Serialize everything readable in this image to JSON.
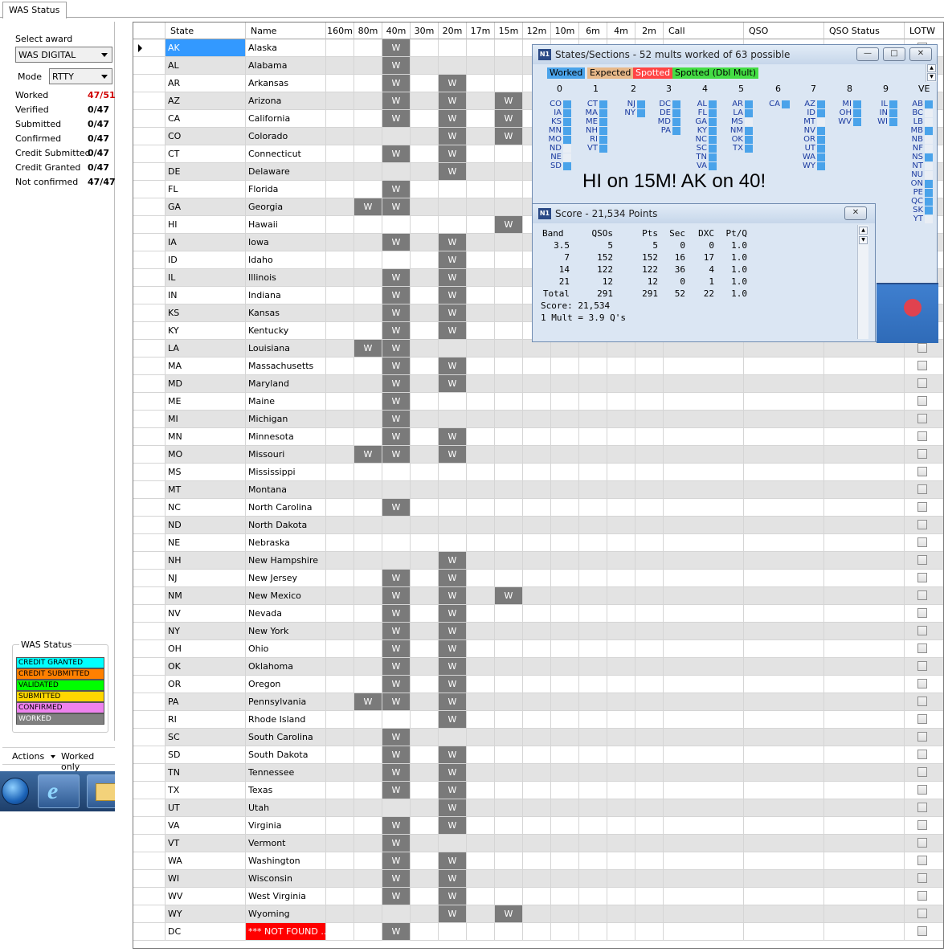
{
  "tab": {
    "label": "WAS Status"
  },
  "left": {
    "select_award_label": "Select award",
    "award_value": "WAS DIGITAL",
    "mode_label": "Mode",
    "mode_value": "RTTY",
    "stats": [
      {
        "label": "Worked",
        "value": "47/51",
        "color": "#d00000"
      },
      {
        "label": "Verified",
        "value": "0/47",
        "color": "#000000"
      },
      {
        "label": "Submitted",
        "value": "0/47",
        "color": "#000000"
      },
      {
        "label": "Confirmed",
        "value": "0/47",
        "color": "#000000"
      },
      {
        "label": "Credit Submitted",
        "value": "0/47",
        "color": "#000000"
      },
      {
        "label": "Credit Granted",
        "value": "0/47",
        "color": "#000000"
      },
      {
        "label": "Not confirmed",
        "value": "47/47",
        "color": "#000000"
      }
    ],
    "legend_title": "WAS Status",
    "legend": [
      {
        "label": "CREDIT GRANTED",
        "color": "#00ffff",
        "text": "#000"
      },
      {
        "label": "CREDIT SUBMITTED",
        "color": "#ff8000",
        "text": "#000"
      },
      {
        "label": "VALIDATED",
        "color": "#00ff00",
        "text": "#000"
      },
      {
        "label": "SUBMITTED",
        "color": "#ffd700",
        "text": "#000"
      },
      {
        "label": "CONFIRMED",
        "color": "#ee82ee",
        "text": "#000"
      },
      {
        "label": "WORKED",
        "color": "#808080",
        "text": "#ffffff"
      }
    ],
    "actions_label": "Actions",
    "worked_only_label": "Worked only"
  },
  "grid": {
    "headers": [
      "State",
      "Name",
      "160m",
      "80m",
      "40m",
      "30m",
      "20m",
      "17m",
      "15m",
      "12m",
      "10m",
      "6m",
      "4m",
      "2m",
      "Call",
      "QSO",
      "QSO Status",
      "LOTW"
    ],
    "worked_mark": "W",
    "rows": [
      {
        "state": "AK",
        "name": "Alaska",
        "worked": [
          "40m"
        ]
      },
      {
        "state": "AL",
        "name": "Alabama",
        "worked": [
          "40m"
        ]
      },
      {
        "state": "AR",
        "name": "Arkansas",
        "worked": [
          "40m",
          "20m"
        ]
      },
      {
        "state": "AZ",
        "name": "Arizona",
        "worked": [
          "40m",
          "20m",
          "15m"
        ]
      },
      {
        "state": "CA",
        "name": "California",
        "worked": [
          "40m",
          "20m",
          "15m"
        ]
      },
      {
        "state": "CO",
        "name": "Colorado",
        "worked": [
          "20m",
          "15m"
        ]
      },
      {
        "state": "CT",
        "name": "Connecticut",
        "worked": [
          "40m",
          "20m"
        ]
      },
      {
        "state": "DE",
        "name": "Delaware",
        "worked": [
          "20m"
        ]
      },
      {
        "state": "FL",
        "name": "Florida",
        "worked": [
          "40m"
        ]
      },
      {
        "state": "GA",
        "name": "Georgia",
        "worked": [
          "80m",
          "40m"
        ]
      },
      {
        "state": "HI",
        "name": "Hawaii",
        "worked": [
          "15m"
        ]
      },
      {
        "state": "IA",
        "name": "Iowa",
        "worked": [
          "40m",
          "20m"
        ]
      },
      {
        "state": "ID",
        "name": "Idaho",
        "worked": [
          "20m"
        ]
      },
      {
        "state": "IL",
        "name": "Illinois",
        "worked": [
          "40m",
          "20m"
        ]
      },
      {
        "state": "IN",
        "name": "Indiana",
        "worked": [
          "40m",
          "20m"
        ]
      },
      {
        "state": "KS",
        "name": "Kansas",
        "worked": [
          "40m",
          "20m"
        ]
      },
      {
        "state": "KY",
        "name": "Kentucky",
        "worked": [
          "40m",
          "20m"
        ]
      },
      {
        "state": "LA",
        "name": "Louisiana",
        "worked": [
          "80m",
          "40m"
        ]
      },
      {
        "state": "MA",
        "name": "Massachusetts",
        "worked": [
          "40m",
          "20m"
        ]
      },
      {
        "state": "MD",
        "name": "Maryland",
        "worked": [
          "40m",
          "20m"
        ]
      },
      {
        "state": "ME",
        "name": "Maine",
        "worked": [
          "40m"
        ]
      },
      {
        "state": "MI",
        "name": "Michigan",
        "worked": [
          "40m"
        ]
      },
      {
        "state": "MN",
        "name": "Minnesota",
        "worked": [
          "40m",
          "20m"
        ]
      },
      {
        "state": "MO",
        "name": "Missouri",
        "worked": [
          "80m",
          "40m",
          "20m"
        ]
      },
      {
        "state": "MS",
        "name": "Mississippi",
        "worked": []
      },
      {
        "state": "MT",
        "name": "Montana",
        "worked": []
      },
      {
        "state": "NC",
        "name": "North Carolina",
        "worked": [
          "40m"
        ]
      },
      {
        "state": "ND",
        "name": "North Dakota",
        "worked": []
      },
      {
        "state": "NE",
        "name": "Nebraska",
        "worked": []
      },
      {
        "state": "NH",
        "name": "New Hampshire",
        "worked": [
          "20m"
        ]
      },
      {
        "state": "NJ",
        "name": "New Jersey",
        "worked": [
          "40m",
          "20m"
        ]
      },
      {
        "state": "NM",
        "name": "New Mexico",
        "worked": [
          "40m",
          "20m",
          "15m"
        ]
      },
      {
        "state": "NV",
        "name": "Nevada",
        "worked": [
          "40m",
          "20m"
        ]
      },
      {
        "state": "NY",
        "name": "New York",
        "worked": [
          "40m",
          "20m"
        ]
      },
      {
        "state": "OH",
        "name": "Ohio",
        "worked": [
          "40m",
          "20m"
        ]
      },
      {
        "state": "OK",
        "name": "Oklahoma",
        "worked": [
          "40m",
          "20m"
        ]
      },
      {
        "state": "OR",
        "name": "Oregon",
        "worked": [
          "40m",
          "20m"
        ]
      },
      {
        "state": "PA",
        "name": "Pennsylvania",
        "worked": [
          "80m",
          "40m",
          "20m"
        ]
      },
      {
        "state": "RI",
        "name": "Rhode Island",
        "worked": [
          "20m"
        ]
      },
      {
        "state": "SC",
        "name": "South Carolina",
        "worked": [
          "40m"
        ]
      },
      {
        "state": "SD",
        "name": "South Dakota",
        "worked": [
          "40m",
          "20m"
        ]
      },
      {
        "state": "TN",
        "name": "Tennessee",
        "worked": [
          "40m",
          "20m"
        ]
      },
      {
        "state": "TX",
        "name": "Texas",
        "worked": [
          "40m",
          "20m"
        ]
      },
      {
        "state": "UT",
        "name": "Utah",
        "worked": [
          "20m"
        ]
      },
      {
        "state": "VA",
        "name": "Virginia",
        "worked": [
          "40m",
          "20m"
        ]
      },
      {
        "state": "VT",
        "name": "Vermont",
        "worked": [
          "40m"
        ]
      },
      {
        "state": "WA",
        "name": "Washington",
        "worked": [
          "40m",
          "20m"
        ]
      },
      {
        "state": "WI",
        "name": "Wisconsin",
        "worked": [
          "40m",
          "20m"
        ]
      },
      {
        "state": "WV",
        "name": "West Virginia",
        "worked": [
          "40m",
          "20m"
        ]
      },
      {
        "state": "WY",
        "name": "Wyoming",
        "worked": [
          "20m",
          "15m"
        ]
      },
      {
        "state": "DC",
        "name": "*** NOT FOUND ...",
        "worked": [
          "40m"
        ],
        "not_found": true
      }
    ]
  },
  "states_window": {
    "title": "States/Sections - 52 mults worked of 63 possible",
    "tags": [
      {
        "label": "Worked",
        "bg": "#4aa3ea",
        "fg": "#000"
      },
      {
        "label": "Expected",
        "bg": "#e8b98a",
        "fg": "#000"
      },
      {
        "label": "Spotted",
        "bg": "#ff4444",
        "fg": "#fff"
      },
      {
        "label": "Spotted (Dbl Mult)",
        "bg": "#44dd44",
        "fg": "#000"
      }
    ],
    "columns": [
      {
        "digit": "0",
        "items": [
          [
            "CO",
            1
          ],
          [
            "IA",
            1
          ],
          [
            "KS",
            1
          ],
          [
            "MN",
            1
          ],
          [
            "MO",
            1
          ],
          [
            "ND",
            0
          ],
          [
            "NE",
            0
          ],
          [
            "SD",
            1
          ]
        ]
      },
      {
        "digit": "1",
        "items": [
          [
            "CT",
            1
          ],
          [
            "MA",
            1
          ],
          [
            "ME",
            1
          ],
          [
            "NH",
            1
          ],
          [
            "RI",
            1
          ],
          [
            "VT",
            1
          ]
        ]
      },
      {
        "digit": "2",
        "items": [
          [
            "NJ",
            1
          ],
          [
            "NY",
            1
          ]
        ]
      },
      {
        "digit": "3",
        "items": [
          [
            "DC",
            1
          ],
          [
            "DE",
            1
          ],
          [
            "MD",
            1
          ],
          [
            "PA",
            1
          ]
        ]
      },
      {
        "digit": "4",
        "items": [
          [
            "AL",
            1
          ],
          [
            "FL",
            1
          ],
          [
            "GA",
            1
          ],
          [
            "KY",
            1
          ],
          [
            "NC",
            1
          ],
          [
            "SC",
            1
          ],
          [
            "TN",
            1
          ],
          [
            "VA",
            1
          ]
        ]
      },
      {
        "digit": "5",
        "items": [
          [
            "AR",
            1
          ],
          [
            "LA",
            1
          ],
          [
            "MS",
            0
          ],
          [
            "NM",
            1
          ],
          [
            "OK",
            1
          ],
          [
            "TX",
            1
          ]
        ]
      },
      {
        "digit": "6",
        "items": [
          [
            "CA",
            1
          ]
        ]
      },
      {
        "digit": "7",
        "items": [
          [
            "AZ",
            1
          ],
          [
            "ID",
            1
          ],
          [
            "MT",
            0
          ],
          [
            "NV",
            1
          ],
          [
            "OR",
            1
          ],
          [
            "UT",
            1
          ],
          [
            "WA",
            1
          ],
          [
            "WY",
            1
          ]
        ]
      },
      {
        "digit": "8",
        "items": [
          [
            "MI",
            1
          ],
          [
            "OH",
            1
          ],
          [
            "WV",
            1
          ]
        ]
      },
      {
        "digit": "9",
        "items": [
          [
            "IL",
            1
          ],
          [
            "IN",
            1
          ],
          [
            "WI",
            1
          ]
        ]
      },
      {
        "digit": "VE",
        "items": [
          [
            "AB",
            1
          ],
          [
            "BC",
            0
          ],
          [
            "LB",
            0
          ],
          [
            "MB",
            1
          ],
          [
            "NB",
            0
          ],
          [
            "NF",
            0
          ],
          [
            "NS",
            1
          ],
          [
            "NT",
            0
          ],
          [
            "NU",
            0
          ],
          [
            "ON",
            1
          ],
          [
            "PE",
            1
          ],
          [
            "QC",
            1
          ],
          [
            "SK",
            1
          ],
          [
            "YT",
            0
          ]
        ]
      }
    ],
    "banner": "HI on 15M!  AK on 40!"
  },
  "score_window": {
    "title": "Score - 21,534 Points",
    "headers": [
      "Band",
      "QSOs",
      "Pts",
      "Sec",
      "DXC",
      "Pt/Q"
    ],
    "rows": [
      [
        "3.5",
        "5",
        "5",
        "0",
        "0",
        "1.0"
      ],
      [
        "7",
        "152",
        "152",
        "16",
        "17",
        "1.0"
      ],
      [
        "14",
        "122",
        "122",
        "36",
        "4",
        "1.0"
      ],
      [
        "21",
        "12",
        "12",
        "0",
        "1",
        "1.0"
      ],
      [
        "Total",
        "291",
        "291",
        "52",
        "22",
        "1.0"
      ]
    ],
    "score_line": "Score: 21,534",
    "mult_line": "1 Mult = 3.9 Q's"
  }
}
